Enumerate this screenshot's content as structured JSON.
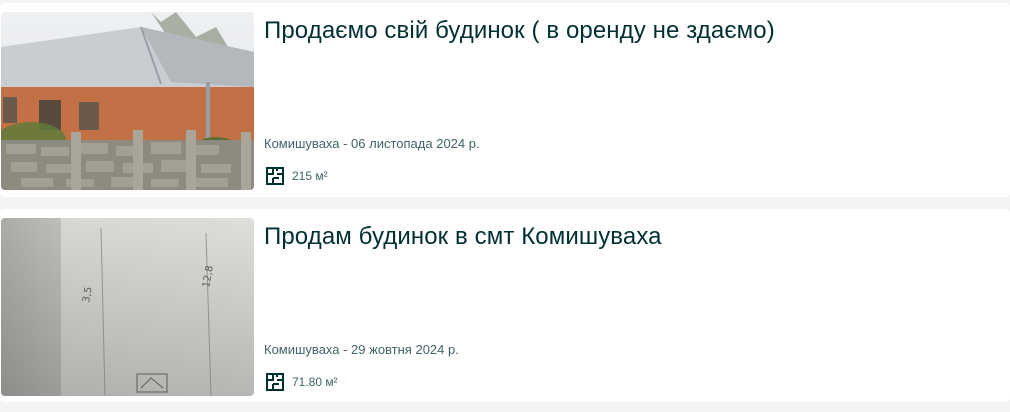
{
  "listings": [
    {
      "title": "Продаємо свій будинок ( в оренду не здаємо)",
      "location_date": "Комишуваха - 06 листопада 2024 р.",
      "area": "215 м²"
    },
    {
      "title": "Продам будинок в смт Комишуваха",
      "location_date": "Комишуваха - 29 жовтня 2024 р.",
      "area": "71.80 м²"
    }
  ],
  "colors": {
    "title": "#002f34",
    "meta": "#406367",
    "background": "#f2f4f5",
    "card": "#ffffff"
  },
  "icons": {
    "area": "floor-plan-icon"
  }
}
